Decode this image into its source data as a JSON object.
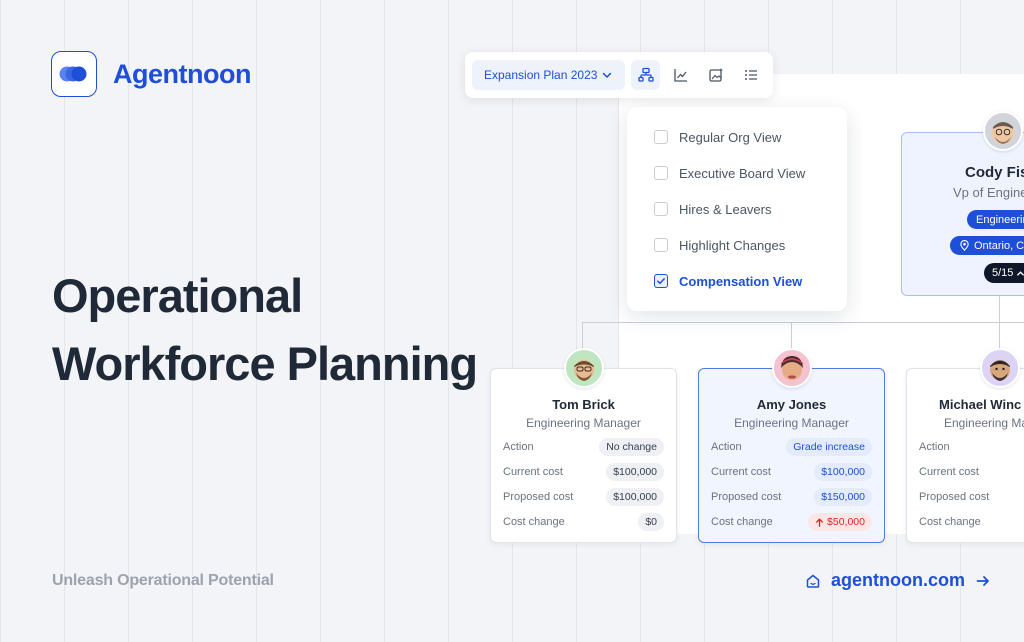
{
  "brand": {
    "name": "Agentnoon"
  },
  "headline": {
    "line1": "Operational",
    "line2": "Workforce Planning"
  },
  "tagline": "Unleash Operational Potential",
  "site": {
    "url_text": "agentnoon.com"
  },
  "toolbar": {
    "plan_select": "Expansion Plan 2023",
    "icons": [
      "org-chart-icon",
      "line-chart-icon",
      "sparkle-image-icon",
      "list-icon"
    ]
  },
  "view_menu": {
    "items": [
      {
        "label": "Regular Org View",
        "checked": false
      },
      {
        "label": "Executive Board View",
        "checked": false
      },
      {
        "label": "Hires & Leavers",
        "checked": false
      },
      {
        "label": "Highlight Changes",
        "checked": false
      },
      {
        "label": "Compensation View",
        "checked": true
      }
    ]
  },
  "boss": {
    "name": "Cody Fis",
    "title": "Vp of Engine",
    "department": "Engineerin",
    "location": "Ontario, Ca",
    "counter": "5/15"
  },
  "employees": [
    {
      "name": "Tom Brick",
      "title": "Engineering Manager",
      "rows": [
        {
          "label": "Action",
          "value": "No change"
        },
        {
          "label": "Current cost",
          "value": "$100,000"
        },
        {
          "label": "Proposed cost",
          "value": "$100,000"
        },
        {
          "label": "Cost change",
          "value": "$0"
        }
      ]
    },
    {
      "name": "Amy Jones",
      "title": "Engineering Manager",
      "rows": [
        {
          "label": "Action",
          "value": "Grade increase"
        },
        {
          "label": "Current cost",
          "value": "$100,000"
        },
        {
          "label": "Proposed cost",
          "value": "$150,000"
        },
        {
          "label": "Cost change",
          "value": "$50,000"
        }
      ]
    },
    {
      "name": "Michael Winc",
      "title": "Engineering Ma",
      "rows": [
        {
          "label": "Action",
          "value": ""
        },
        {
          "label": "Current cost",
          "value": ""
        },
        {
          "label": "Proposed cost",
          "value": "$"
        },
        {
          "label": "Cost change",
          "value": ""
        }
      ]
    }
  ],
  "colors": {
    "brand": "#1d4fd8",
    "text_dark": "#1f2937",
    "increase_red": "#dc2626"
  }
}
